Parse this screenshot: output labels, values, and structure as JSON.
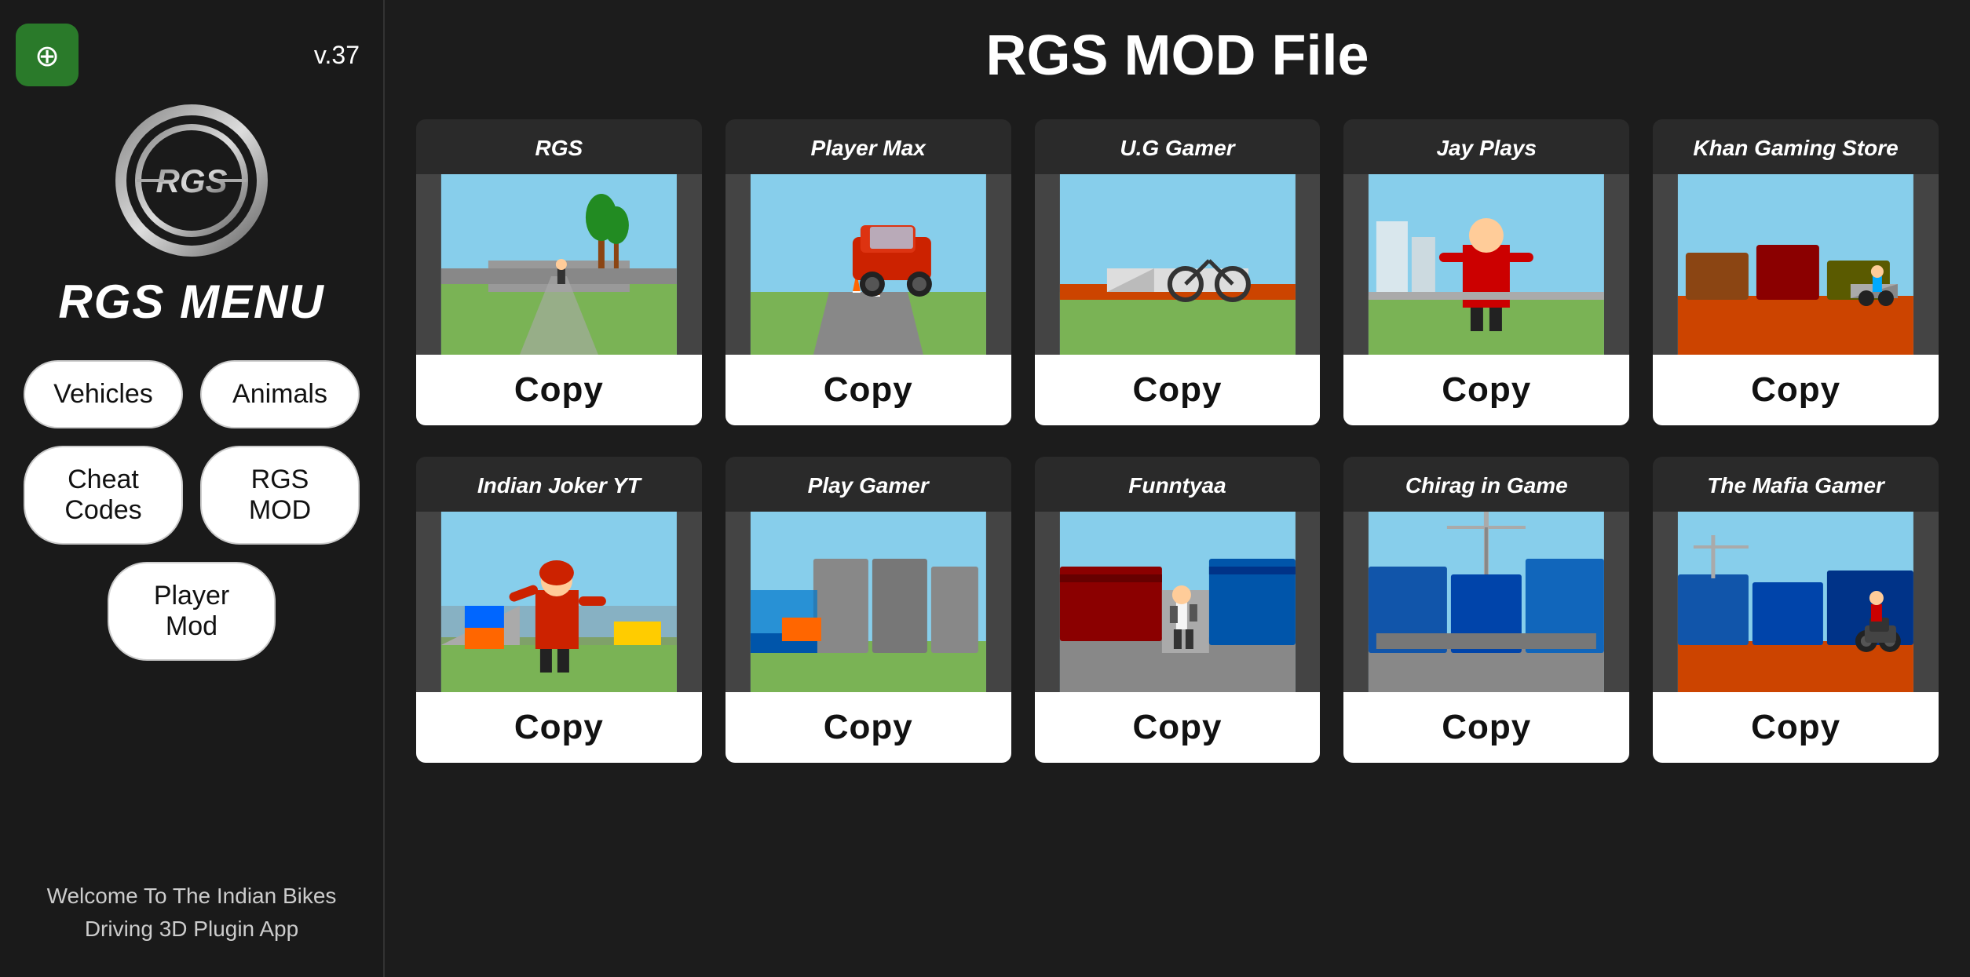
{
  "sidebar": {
    "version": "v.37",
    "logo_alt": "RGS Logo",
    "app_icon_symbol": "⊕",
    "menu_title": "RGS MENU",
    "buttons": [
      {
        "id": "vehicles",
        "label": "Vehicles",
        "wide": false
      },
      {
        "id": "animals",
        "label": "Animals",
        "wide": false
      },
      {
        "id": "cheat-codes",
        "label": "Cheat Codes",
        "wide": false
      },
      {
        "id": "rgs-mod",
        "label": "RGS MOD",
        "wide": false
      },
      {
        "id": "player-mod",
        "label": "Player Mod",
        "wide": true
      }
    ],
    "welcome": "Welcome To The Indian Bikes\nDriving 3D Plugin App"
  },
  "main": {
    "title": "RGS MOD File",
    "rows": [
      {
        "cards": [
          {
            "id": "rgs",
            "label": "RGS",
            "copy_label": "Copy"
          },
          {
            "id": "player-max",
            "label": "Player Max",
            "copy_label": "Copy"
          },
          {
            "id": "ug-gamer",
            "label": "U.G Gamer",
            "copy_label": "Copy"
          },
          {
            "id": "jay-plays",
            "label": "Jay Plays",
            "copy_label": "Copy"
          },
          {
            "id": "khan-gaming",
            "label": "Khan Gaming Store",
            "copy_label": "Copy"
          }
        ]
      },
      {
        "cards": [
          {
            "id": "indian-joker",
            "label": "Indian Joker YT",
            "copy_label": "Copy"
          },
          {
            "id": "play-gamer",
            "label": "Play Gamer",
            "copy_label": "Copy"
          },
          {
            "id": "funntyaa",
            "label": "Funntyaa",
            "copy_label": "Copy"
          },
          {
            "id": "chirag-game",
            "label": "Chirag in Game",
            "copy_label": "Copy"
          },
          {
            "id": "mafia-gamer",
            "label": "The Mafia Gamer",
            "copy_label": "Copy"
          }
        ]
      }
    ]
  }
}
